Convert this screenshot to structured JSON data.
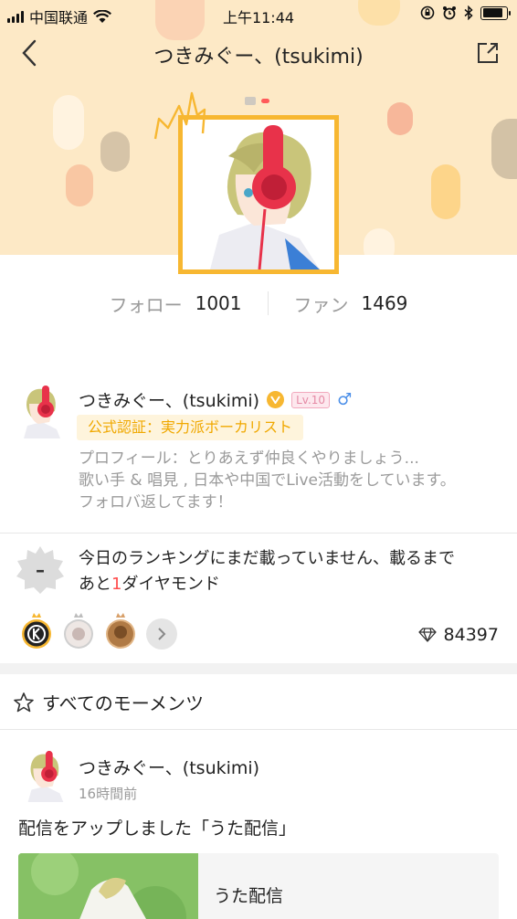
{
  "status_bar": {
    "carrier": "中国联通",
    "time": "上午11:44",
    "icons": [
      "signal-icon",
      "wifi-icon",
      "lock-rotation-icon",
      "alarm-icon",
      "bluetooth-icon",
      "battery-icon"
    ]
  },
  "nav": {
    "title": "つきみぐー、(tsukimi)",
    "back_icon": "chevron-left-icon",
    "share_icon": "share-icon"
  },
  "stats": {
    "follow_label": "フォロー",
    "follow_count": "1001",
    "fans_label": "ファン",
    "fans_count": "1469"
  },
  "profile": {
    "name": "つきみぐー、(tsukimi)",
    "level": "Lv.10",
    "gender": "♂",
    "certification": "公式認証：実力派ボーカリスト",
    "bio": [
      "プロフィール：とりあえず仲良くやりましょう...",
      "歌い手 & 唱見 , 日本や中国でLive活動をしています。",
      "フォロバ返してます！"
    ]
  },
  "ranking": {
    "rank_mark": "–",
    "line1": "今日のランキングにまだ載っていません、載るまで",
    "line2_prefix": "あと",
    "line2_number": "1",
    "line2_suffix": "ダイヤモンド",
    "diamonds": "84397"
  },
  "moments": {
    "header": "すべてのモーメンツ",
    "post": {
      "author": "つきみぐー、(tsukimi)",
      "time": "16時間前",
      "text": "配信をアップしました「うた配信」",
      "card_title": "うた配信"
    }
  },
  "colors": {
    "hero_bg": "#fde9c6",
    "accent_gold": "#f7b731",
    "red": "#ff4d4d"
  }
}
